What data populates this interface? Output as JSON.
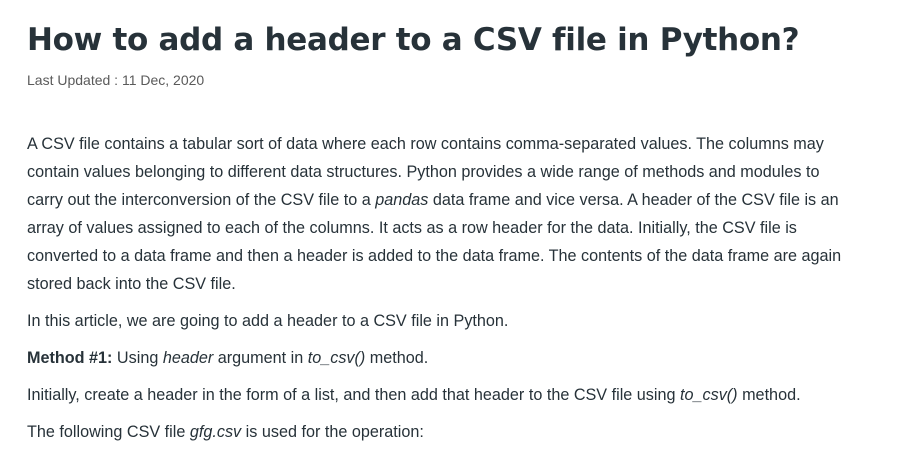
{
  "article": {
    "title": "How to add a header to a CSV file in Python?",
    "last_updated": "Last Updated : 11 Dec, 2020",
    "p1": {
      "a": "A CSV file contains a tabular sort of data where each row contains comma-separated values. The columns may contain values belonging to different data structures. Python provides a wide range of methods and modules to carry out the interconversion of the CSV file to a ",
      "em": "pandas",
      "b": " data frame and vice versa. A header of the CSV file is an array of values assigned to each of the columns. It acts as a row header for the data. Initially, the CSV file is converted to a data frame and then a header is added to the data frame. The contents of the data frame are again stored back into the CSV file."
    },
    "p2": "In this article, we are going to add a header to a CSV file in Python.",
    "p3": {
      "strong": "Method #1:",
      "a": " Using ",
      "em1": "header",
      "b": " argument in ",
      "em2": "to_csv()",
      "c": " method."
    },
    "p4": {
      "a": "Initially, create a header in the form of a list, and then add that header to the CSV file using ",
      "em": "to_csv()",
      "b": " method."
    },
    "p5": {
      "a": "The following CSV file ",
      "em": "gfg.csv",
      "b": " is used for the operation:"
    }
  }
}
